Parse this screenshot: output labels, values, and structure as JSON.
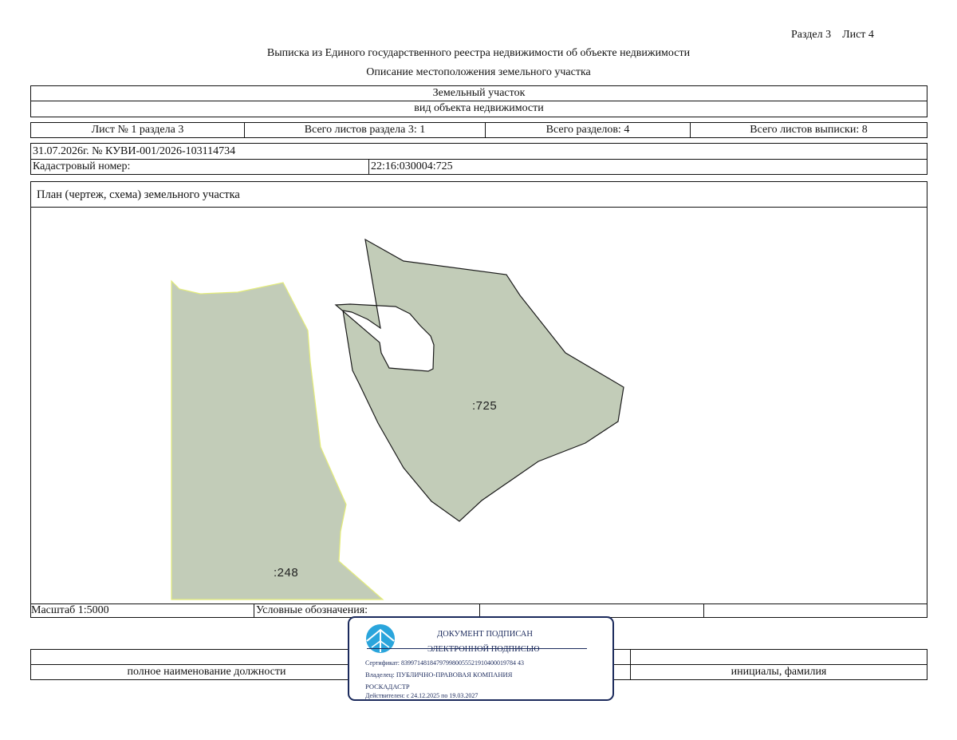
{
  "header": {
    "section_sheet": "Раздел 3    Лист 4",
    "title": "Выписка из Единого государственного реестра недвижимости об объекте недвижимости",
    "subtitle": "Описание местоположения земельного участка"
  },
  "object": {
    "type": "Земельный участок",
    "type_caption": "вид объекта недвижимости"
  },
  "sheets": {
    "sheet_no": "Лист № 1 раздела 3",
    "total_sheets_section": "Всего листов раздела 3: 1",
    "total_sections": "Всего разделов: 4",
    "total_sheets_extract": "Всего листов выписки: 8"
  },
  "record": {
    "date_number": "31.07.2026г. № КУВИ-001/2026-103114734",
    "cadastral_label": "Кадастровый номер:",
    "cadastral_value": "22:16:030004:725"
  },
  "plan": {
    "title": "План (чертеж, схема) земельного участка",
    "parcel_main_label": ":725",
    "parcel_neighbor_label": ":248",
    "colors": {
      "parcel_fill": "#c2ccb8",
      "parcel_main_stroke": "#1a1a1a",
      "parcel_neighbor_stroke": "#e4ec7a"
    }
  },
  "footer": {
    "scale": "Масштаб 1:5000",
    "legend_label": "Условные обозначения:",
    "position_caption": "полное наименование должности",
    "name_caption": "инициалы, фамилия"
  },
  "stamp": {
    "line1": "ДОКУМЕНТ ПОДПИСАН",
    "line2": "ЭЛЕКТРОННОЙ ПОДПИСЬЮ",
    "certificate": "Сертификат: 839971481847979980055521910400019784 43",
    "owner_line1": "Владелец: ПУБЛИЧНО-ПРАВОВАЯ КОМПАНИЯ",
    "owner_line2": "РОСКАДАСТР",
    "valid": "Действителен: с 24.12.2025 по 19.03.2027",
    "colors": {
      "frame": "#1b2a5c",
      "emblem": "#2aa5dc"
    }
  }
}
